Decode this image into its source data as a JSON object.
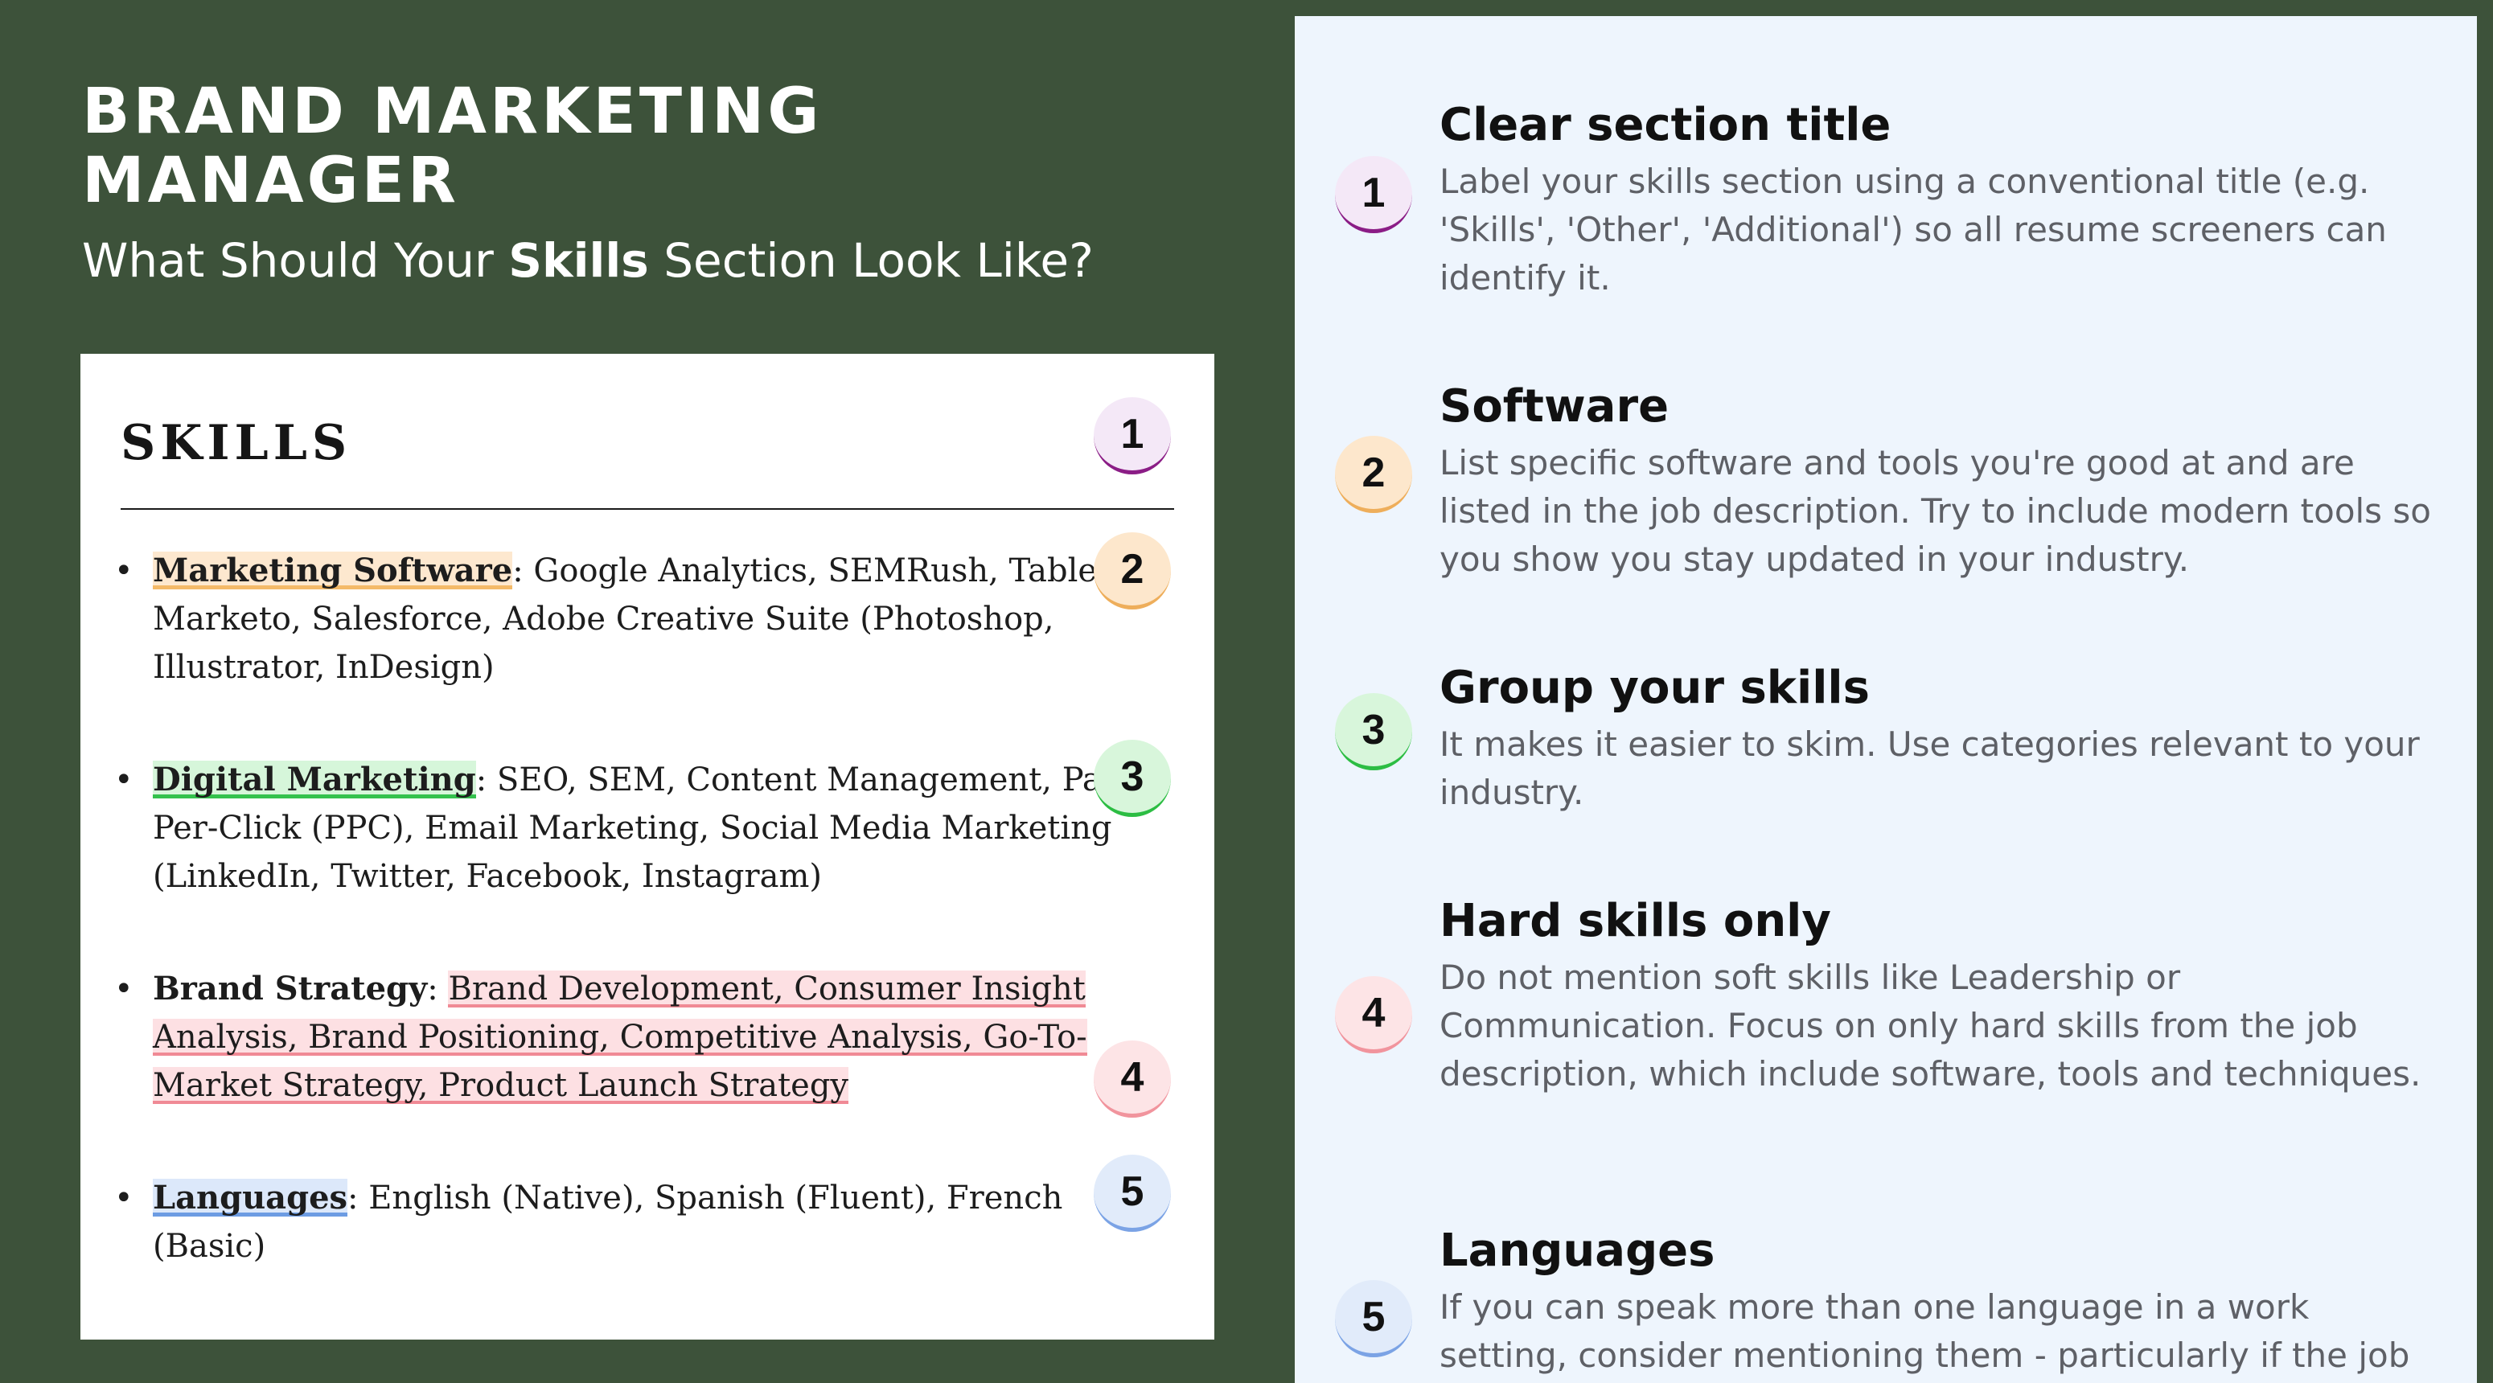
{
  "header": {
    "title": "BRAND MARKETING MANAGER",
    "subtitle_prefix": "What Should Your ",
    "subtitle_emphasis": "Skills",
    "subtitle_suffix": " Section Look Like?"
  },
  "resume": {
    "section_heading": "SKILLS",
    "bullet": "•",
    "items": [
      {
        "category": "Marketing Software",
        "separator": ": ",
        "text": "Google Analytics, SEMRush, Tableau,\nMarketo, Salesforce, Adobe Creative Suite (Photoshop,\nIllustrator, InDesign)"
      },
      {
        "category": "Digital Marketing",
        "separator": ": ",
        "text": "SEO, SEM, Content Management, Pay-\nPer-Click (PPC), Email Marketing, Social Media Marketing\n(LinkedIn, Twitter, Facebook, Instagram)"
      },
      {
        "category": "Brand Strategy",
        "separator": ": ",
        "text": "Brand Development, Consumer Insight\nAnalysis, Brand Positioning, Competitive Analysis, Go-To-\nMarket Strategy, Product Launch Strategy"
      },
      {
        "category": "Languages",
        "separator": ": ",
        "text": "English (Native), Spanish (Fluent), French\n(Basic)"
      }
    ]
  },
  "markers": [
    "1",
    "2",
    "3",
    "4",
    "5"
  ],
  "marker_colors": {
    "1": "#8b1d86",
    "2": "#eeae5b",
    "3": "#2cbd43",
    "4": "#f1949d",
    "5": "#7ba3e5"
  },
  "tips": [
    {
      "number": "1",
      "title": "Clear section title",
      "description": "Label your skills section using a conventional title (e.g. 'Skills', 'Other', 'Additional') so all resume screeners can identify it."
    },
    {
      "number": "2",
      "title": "Software",
      "description": "List specific software and tools you're good at and are listed in the job description. Try to include modern tools so you show you stay updated in your industry."
    },
    {
      "number": "3",
      "title": "Group your skills",
      "description": "It makes it easier to skim. Use categories relevant to your industry."
    },
    {
      "number": "4",
      "title": "Hard skills only",
      "description": "Do not mention soft skills like Leadership or Communication. Focus on only hard skills from the job description, which include software, tools and techniques."
    },
    {
      "number": "5",
      "title": "Languages",
      "description": "If you can speak more than one language in a work setting, consider mentioning them - particularly if the job"
    }
  ],
  "colors": {
    "page_background": "#3d523a",
    "card_background": "#ffffff",
    "panel_background": "#eef5fd"
  }
}
